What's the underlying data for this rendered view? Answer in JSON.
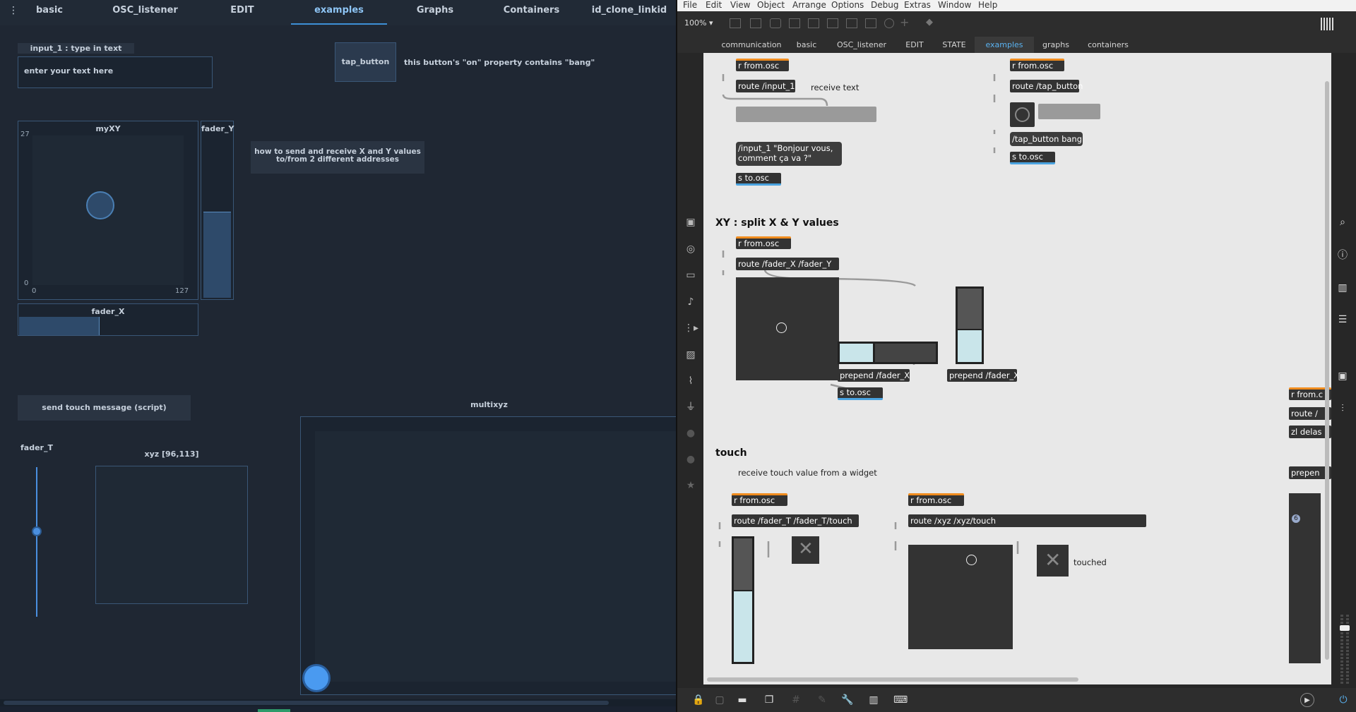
{
  "osc": {
    "menu_glyph": "⋮",
    "tabs": [
      "basic",
      "OSC_listener",
      "EDIT",
      "examples",
      "Graphs",
      "Containers",
      "id_clone_linkid"
    ],
    "input1": {
      "label": "input_1 : type in text",
      "placeholder": "enter your text here"
    },
    "tap_button": {
      "label": "tap_button",
      "description": "this button's \"on\" property contains \"bang\""
    },
    "myxy": {
      "label": "myXY",
      "y_max": "27",
      "y_min": "0",
      "x_min": "0",
      "x_max": "127"
    },
    "fader_y": {
      "label": "fader_Y",
      "level": 0.53
    },
    "fader_x": {
      "label": "fader_X",
      "level": 0.45
    },
    "xy_note": "how to send and receive X and Y values to/from 2 different addresses",
    "touch_button": "send touch message (script)",
    "fader_t": {
      "label": "fader_T",
      "level": 0.57
    },
    "xyz": {
      "label": "xyz [96,113]"
    },
    "multixyz": {
      "label": "multixyz"
    }
  },
  "max": {
    "menu": [
      "File",
      "Edit",
      "View",
      "Object",
      "Arrange",
      "Options",
      "Debug",
      "Extras",
      "Window",
      "Help"
    ],
    "zoom": "100%",
    "tabs": [
      "communication",
      "basic",
      "OSC_listener",
      "EDIT",
      "STATE",
      "examples",
      "graphs",
      "containers"
    ],
    "active_tab": "examples",
    "objects": {
      "r1": "r from.osc",
      "route_input": "route /input_1",
      "receive_text": "receive text",
      "msg_bonjour_1": "/input_1 \"Bonjour vous,",
      "msg_bonjour_2": "comment ça va ?\"",
      "s1": "s to.osc",
      "r2": "r from.osc",
      "route_tap": "route /tap_button",
      "msg_tap": "/tap_button bang",
      "s2": "s to.osc",
      "xy_header": "XY : split X & Y values",
      "r3": "r from.osc",
      "route_xy": "route /fader_X /fader_Y",
      "prepend_x": "prepend /fader_X",
      "prepend_x2": "prepend /fader_X",
      "s3": "s to.osc",
      "touch_header": "touch",
      "touch_note": "receive touch value from a widget",
      "r4": "r from.osc",
      "route_touch": "route /fader_T /fader_T/touch",
      "r5": "r from.osc",
      "route_xyz": "route /xyz /xyz/touch",
      "touched": "touched",
      "edge_r": "r from.c",
      "edge_route": "route /",
      "edge_zl": "zl delas",
      "edge_prepend": "prepen",
      "edge_num": "6"
    }
  }
}
